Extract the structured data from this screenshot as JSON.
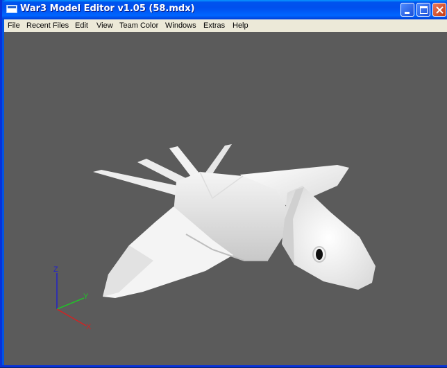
{
  "window": {
    "title": "War3 Model Editor v1.05 (58.mdx)",
    "buttons": {
      "minimize": "minimize",
      "maximize": "maximize",
      "close": "close"
    }
  },
  "menubar": {
    "items": [
      "File",
      "Recent Files",
      "Edit",
      "View",
      "Team Color",
      "Windows",
      "Extras",
      "Help"
    ]
  },
  "viewport": {
    "background_color": "#5b5b5b",
    "axes": {
      "z_label": "Z",
      "y_label": "Y",
      "x_label": "X",
      "z_color": "#2323c8",
      "y_color": "#22c02a",
      "x_color": "#d42222"
    }
  },
  "colors": {
    "titlebar": "#0054e3",
    "menubar": "#ece9d8",
    "model": "#ffffff"
  }
}
